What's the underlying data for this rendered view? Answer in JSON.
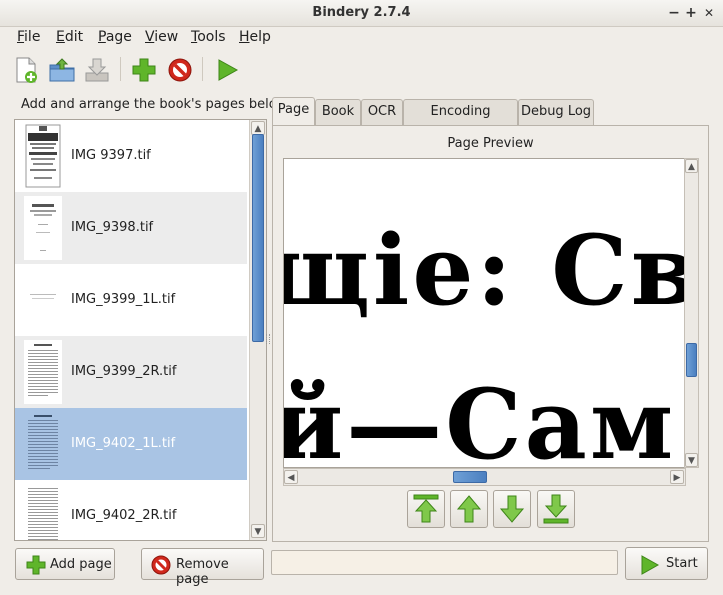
{
  "window": {
    "title": "Bindery 2.7.4",
    "controls": {
      "minimize": "−",
      "maximize": "+",
      "close": "✕"
    }
  },
  "menubar": [
    {
      "label": "File",
      "mnemonic": "F",
      "rest": "ile"
    },
    {
      "label": "Edit",
      "mnemonic": "E",
      "rest": "dit"
    },
    {
      "label": "Page",
      "mnemonic": "P",
      "rest": "age"
    },
    {
      "label": "View",
      "mnemonic": "V",
      "rest": "iew"
    },
    {
      "label": "Tools",
      "mnemonic": "T",
      "rest": "ools"
    },
    {
      "label": "Help",
      "mnemonic": "H",
      "rest": "elp"
    }
  ],
  "toolbar": {
    "icons": [
      "new-document-icon",
      "open-folder-icon",
      "save-icon",
      "add-icon",
      "remove-icon",
      "run-icon"
    ]
  },
  "left": {
    "header": "Add and arrange the book's pages below",
    "pages": [
      {
        "name": "IMG 9397.tif",
        "selected": false
      },
      {
        "name": "IMG_9398.tif",
        "selected": false
      },
      {
        "name": "IMG_9399_1L.tif",
        "selected": false
      },
      {
        "name": "IMG_9399_2R.tif",
        "selected": false
      },
      {
        "name": "IMG_9402_1L.tif",
        "selected": true
      },
      {
        "name": "IMG_9402_2R.tif",
        "selected": false
      }
    ],
    "add_button": "Add page",
    "remove_button": "Remove page"
  },
  "tabs": [
    {
      "label": "Page",
      "active": true
    },
    {
      "label": "Book",
      "active": false
    },
    {
      "label": "OCR",
      "active": false
    },
    {
      "label": "Encoding Options",
      "active": false
    },
    {
      "label": "Debug Log",
      "active": false
    }
  ],
  "preview": {
    "label": "Page Preview",
    "line1": "щіе: Свя",
    "line2": "й—Сам"
  },
  "nav": {
    "icons": [
      "move-to-top-icon",
      "move-up-icon",
      "move-down-icon",
      "move-to-bottom-icon"
    ]
  },
  "start_button": "Start",
  "colors": {
    "selection": "#a9c4e4",
    "accent": "#4b7fc0",
    "green": "#5fb52a",
    "red": "#d0281c"
  }
}
